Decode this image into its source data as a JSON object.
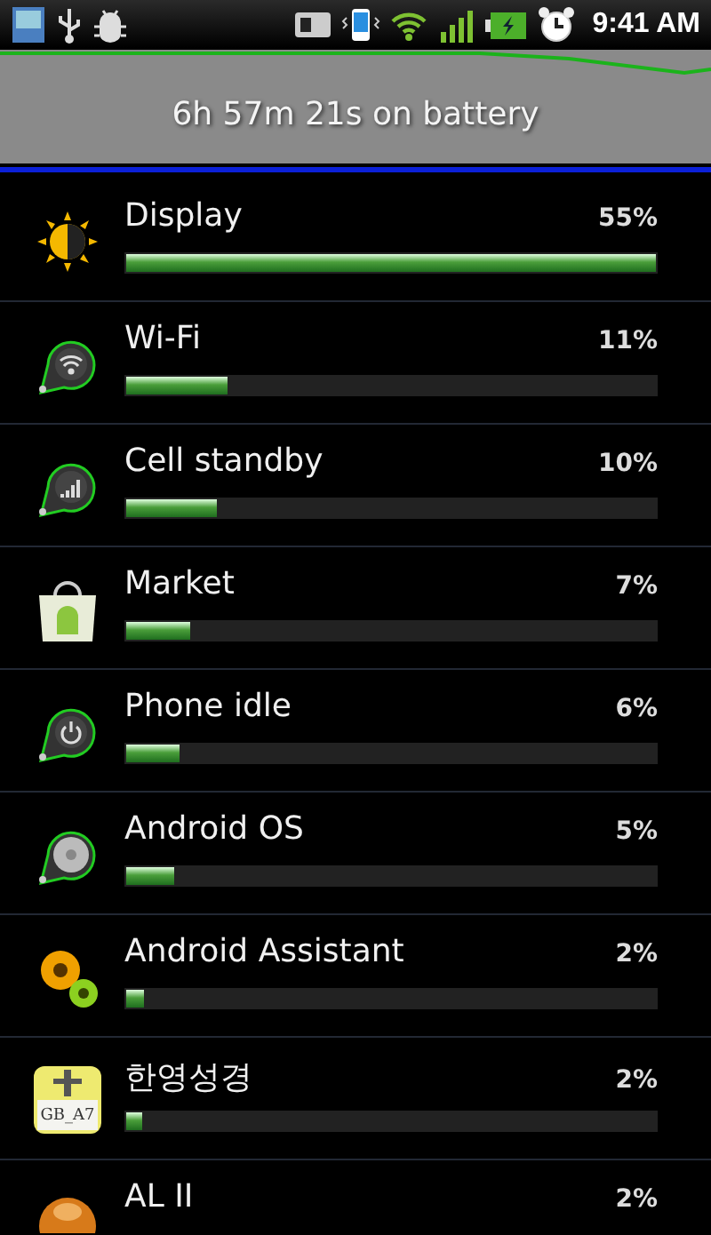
{
  "status_bar": {
    "time": "9:41 AM"
  },
  "summary": {
    "text": "6h 57m 21s on battery"
  },
  "items": [
    {
      "name": "Display",
      "percent": "55%",
      "level": 1.0,
      "kind": "sun"
    },
    {
      "name": "Wi-Fi",
      "percent": "11%",
      "level": 0.19,
      "kind": "wifi"
    },
    {
      "name": "Cell standby",
      "percent": "10%",
      "level": 0.17,
      "kind": "signal"
    },
    {
      "name": "Market",
      "percent": "7%",
      "level": 0.12,
      "kind": "bag"
    },
    {
      "name": "Phone idle",
      "percent": "6%",
      "level": 0.1,
      "kind": "power"
    },
    {
      "name": "Android OS",
      "percent": "5%",
      "level": 0.09,
      "kind": "disc"
    },
    {
      "name": "Android Assistant",
      "percent": "2%",
      "level": 0.033,
      "kind": "gears"
    },
    {
      "name": "한영성경",
      "percent": "2%",
      "level": 0.03,
      "kind": "book",
      "icon_text": "GB_A7"
    },
    {
      "name": "AL II",
      "percent": "2%",
      "kind": "orb"
    }
  ]
}
